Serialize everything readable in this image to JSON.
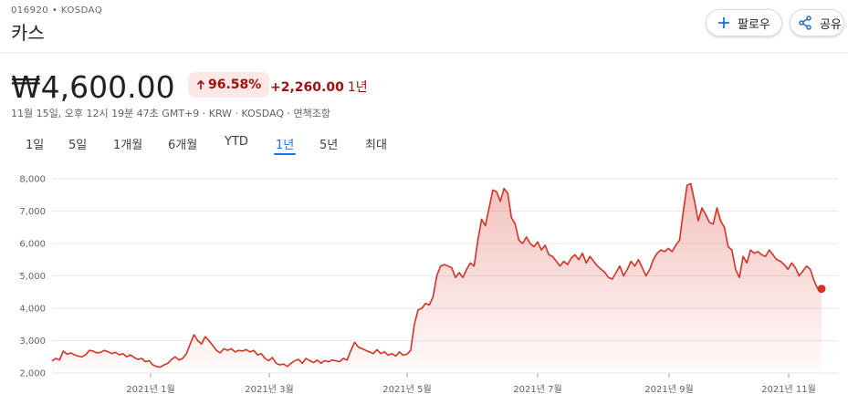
{
  "header": {
    "ticker": "016920 • KOSDAQ",
    "company": "카스",
    "follow_label": "팔로우",
    "share_label": "공유",
    "follow_icon": "plus-icon",
    "share_icon": "share-icon"
  },
  "quote": {
    "price": "₩4,600.00",
    "change_percent": "96.58%",
    "change_value": "+2,260.00",
    "change_period": "1년",
    "meta": "11월 15일, 오후 12시 19분 47초 GMT+9 · KRW · KOSDAQ · 면책조항",
    "accent_color": "#d93025",
    "positive_color": "#a50e0e"
  },
  "range_tabs": {
    "items": [
      "1일",
      "5일",
      "1개월",
      "6개월",
      "YTD",
      "1년",
      "5년",
      "최대"
    ],
    "selected": "1년"
  },
  "chart_data": {
    "type": "area",
    "y_ticks": [
      "8,000",
      "7,000",
      "6,000",
      "5,000",
      "4,000",
      "3,000",
      "2,000"
    ],
    "x_ticks": [
      "2021년 1월",
      "2021년 3월",
      "2021년 5월",
      "2021년 7월",
      "2021년 9월",
      "2021년 11월"
    ],
    "ylim": [
      2000,
      8000
    ],
    "grid": true,
    "line_color": "#d93025",
    "series": [
      {
        "values": [
          2370,
          2450,
          2400,
          2680,
          2580,
          2620,
          2560,
          2520,
          2500,
          2560,
          2700,
          2680,
          2620,
          2640,
          2700,
          2660,
          2600,
          2640,
          2560,
          2600,
          2500,
          2560,
          2480,
          2420,
          2450,
          2350,
          2380,
          2250,
          2200,
          2180,
          2250,
          2300,
          2420,
          2500,
          2400,
          2450,
          2600,
          2900,
          3180,
          3000,
          2900,
          3120,
          3000,
          2850,
          2700,
          2620,
          2750,
          2700,
          2750,
          2650,
          2700,
          2680,
          2720,
          2650,
          2700,
          2560,
          2600,
          2450,
          2380,
          2480,
          2300,
          2250,
          2280,
          2200,
          2300,
          2380,
          2420,
          2300,
          2450,
          2380,
          2320,
          2400,
          2300,
          2380,
          2350,
          2400,
          2380,
          2350,
          2450,
          2400,
          2700,
          2950,
          2800,
          2750,
          2700,
          2650,
          2600,
          2720,
          2600,
          2650,
          2550,
          2600,
          2520,
          2650,
          2550,
          2580,
          2700,
          3500,
          3950,
          4000,
          4150,
          4100,
          4350,
          5000,
          5300,
          5350,
          5300,
          5250,
          4950,
          5100,
          4950,
          5200,
          5400,
          5300,
          6100,
          6750,
          6550,
          7100,
          7650,
          7600,
          7300,
          7700,
          7550,
          6800,
          6600,
          6100,
          6000,
          6200,
          6000,
          5900,
          6050,
          5800,
          5950,
          5650,
          5600,
          5450,
          5300,
          5450,
          5350,
          5550,
          5650,
          5500,
          5700,
          5400,
          5600,
          5450,
          5300,
          5200,
          5100,
          4950,
          4900,
          5100,
          5300,
          5000,
          5200,
          5450,
          5300,
          5500,
          5250,
          5000,
          5200,
          5500,
          5700,
          5800,
          5750,
          5850,
          5750,
          5950,
          6100,
          7000,
          7800,
          7850,
          7300,
          6700,
          7100,
          6900,
          6650,
          6600,
          7100,
          6700,
          6500,
          5900,
          5800,
          5200,
          4950,
          5600,
          5400,
          5800,
          5700,
          5750,
          5650,
          5600,
          5800,
          5650,
          5500,
          5450,
          5350,
          5200,
          5400,
          5250,
          5000,
          5150,
          5300,
          5200,
          4850,
          4600,
          4600
        ]
      }
    ],
    "last_value": 4600
  }
}
